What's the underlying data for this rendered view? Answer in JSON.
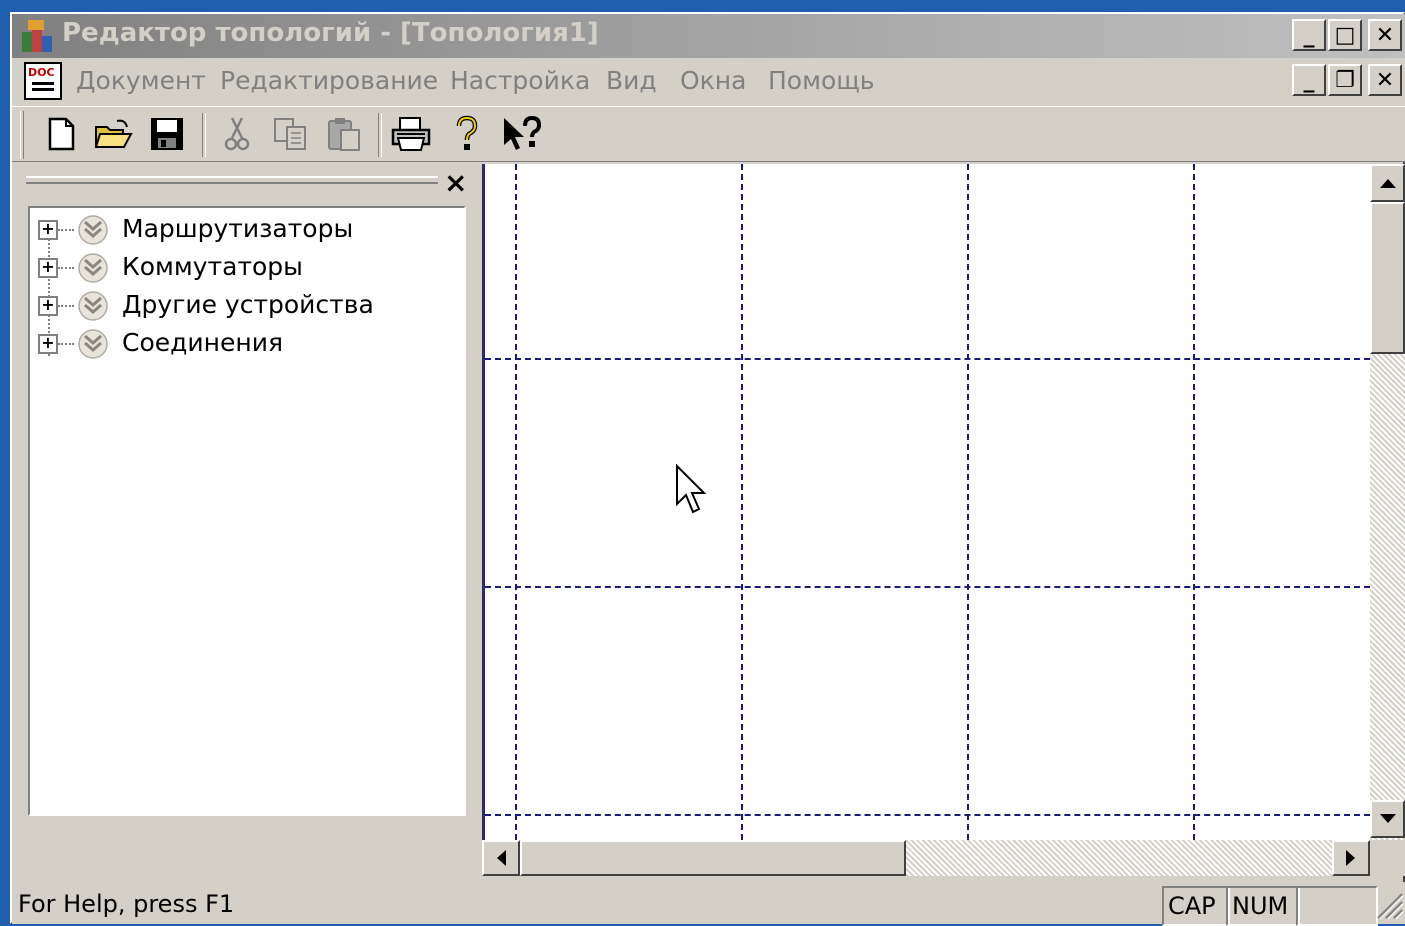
{
  "window": {
    "title": "Редактор топологий - [Топология1]",
    "caption_buttons": {
      "minimize": "_",
      "maximize": "□",
      "close": "✕"
    },
    "mdi_buttons": {
      "minimize": "_",
      "restore": "❐",
      "close": "✕"
    }
  },
  "menu": {
    "doc_icon_label": "DOC",
    "items": [
      "Документ",
      "Редактирование",
      "Настройка",
      "Вид",
      "Окна",
      "Помощь"
    ]
  },
  "toolbar": {
    "buttons": [
      "new-file-icon",
      "open-folder-icon",
      "save-icon",
      "cut-icon",
      "copy-icon",
      "paste-icon",
      "print-icon",
      "help-icon",
      "context-help-icon"
    ]
  },
  "tree": {
    "close_label": "×",
    "expander": "+",
    "items": [
      {
        "label": "Маршрутизаторы"
      },
      {
        "label": "Коммутаторы"
      },
      {
        "label": "Другие устройства"
      },
      {
        "label": "Соединения"
      }
    ]
  },
  "status": {
    "help_text": "For Help, press F1",
    "cap": "CAP",
    "num": "NUM",
    "scrl": ""
  },
  "colors": {
    "desktop": "#1f5fb0",
    "face": "#d4d0c8",
    "grid_line": "#1a1a7a"
  }
}
